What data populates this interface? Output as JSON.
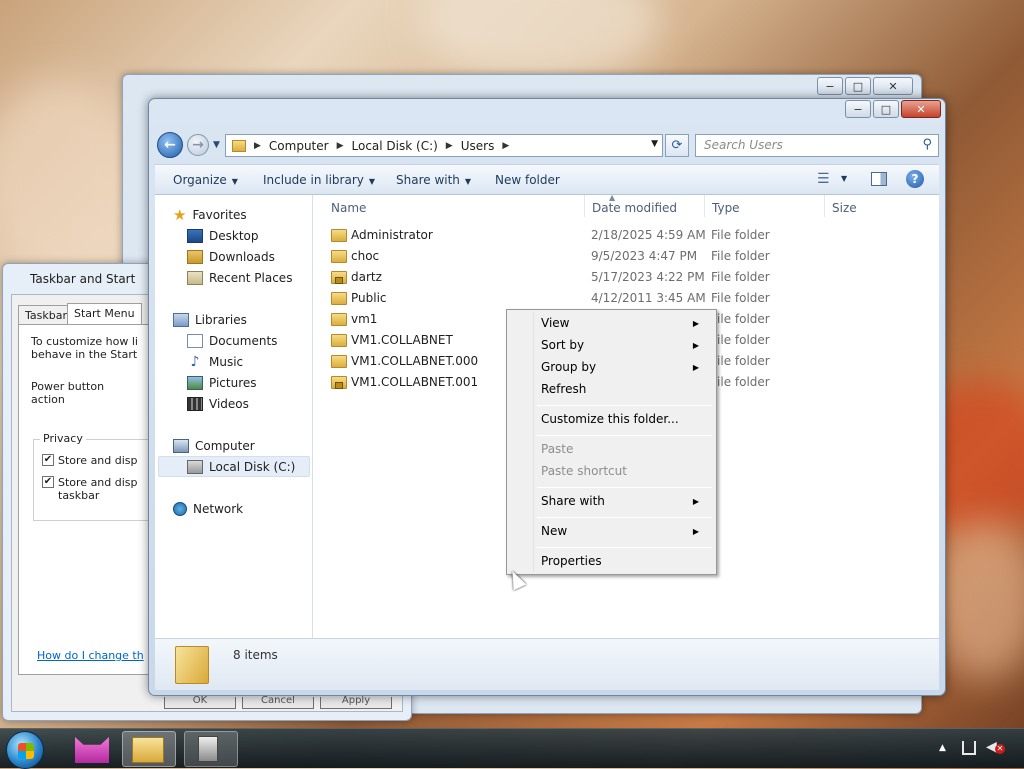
{
  "back_window": {
    "controls": [
      "−",
      "□",
      "✕"
    ]
  },
  "dialog": {
    "title": "Taskbar and Start",
    "tabs": [
      "Taskbar",
      "Start Menu"
    ],
    "intro": "To customize how li behave in the Start",
    "power_label": "Power button action",
    "privacy_label": "Privacy",
    "check1": "Store and disp",
    "check2": "Store and disp taskbar",
    "help_link": "How do I change th",
    "buttons": [
      "OK",
      "Cancel",
      "Apply"
    ]
  },
  "explorer": {
    "controls": [
      "−",
      "□",
      "✕"
    ],
    "breadcrumb": [
      "Computer",
      "Local Disk (C:)",
      "Users"
    ],
    "search_placeholder": "Search Users",
    "toolbar": {
      "organize": "Organize",
      "include": "Include in library",
      "share": "Share with",
      "new_folder": "New folder"
    },
    "nav": {
      "favorites": "Favorites",
      "desktop": "Desktop",
      "downloads": "Downloads",
      "recent": "Recent Places",
      "libraries": "Libraries",
      "documents": "Documents",
      "music": "Music",
      "pictures": "Pictures",
      "videos": "Videos",
      "computer": "Computer",
      "local_disk": "Local Disk (C:)",
      "network": "Network"
    },
    "columns": {
      "name": "Name",
      "date": "Date modified",
      "type": "Type",
      "size": "Size"
    },
    "files": [
      {
        "name": "Administrator",
        "date": "2/18/2025 4:59 AM",
        "type": "File folder"
      },
      {
        "name": "choc",
        "date": "9/5/2023 4:47 PM",
        "type": "File folder"
      },
      {
        "name": "dartz",
        "date": "5/17/2023 4:22 PM",
        "type": "File folder"
      },
      {
        "name": "Public",
        "date": "4/12/2011 3:45 AM",
        "type": "File folder"
      },
      {
        "name": "vm1",
        "date": "",
        "type": "File folder"
      },
      {
        "name": "VM1.COLLABNET",
        "date": "",
        "type": "File folder"
      },
      {
        "name": "VM1.COLLABNET.000",
        "date": "",
        "type": "File folder"
      },
      {
        "name": "VM1.COLLABNET.001",
        "date": "",
        "type": "File folder"
      }
    ],
    "status": "8 items"
  },
  "context_menu": {
    "view": "View",
    "sort_by": "Sort by",
    "group_by": "Group by",
    "refresh": "Refresh",
    "customize": "Customize this folder...",
    "paste": "Paste",
    "paste_shortcut": "Paste shortcut",
    "share_with": "Share with",
    "new": "New",
    "properties": "Properties"
  }
}
